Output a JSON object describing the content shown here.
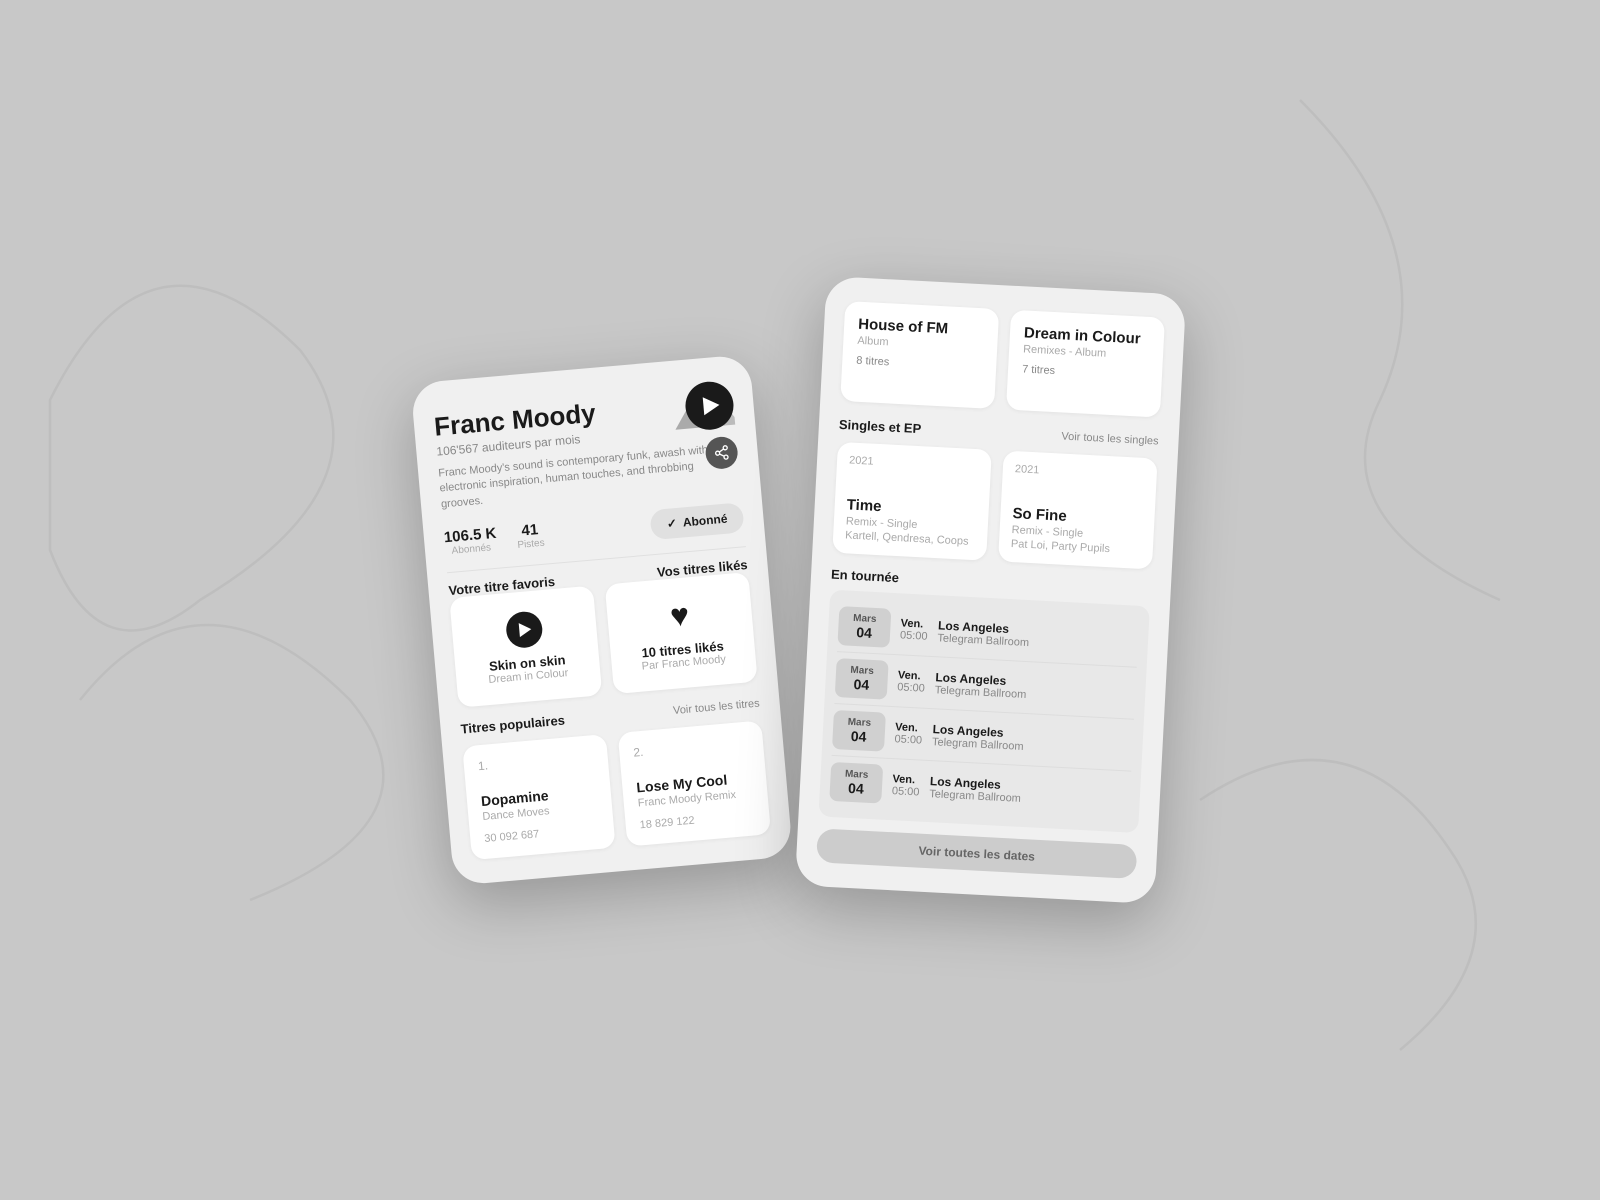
{
  "background": {
    "color": "#c8c8c8"
  },
  "leftPhone": {
    "artist": {
      "name": "Franc Moody",
      "listeners": "106'567 auditeurs par mois",
      "bio": "Franc Moody's sound is contemporary funk, awash with electronic inspiration, human touches, and throbbing grooves.",
      "stats": {
        "followers": "106.5 K",
        "followers_label": "Abonnés",
        "tracks": "41",
        "tracks_label": "Pistes"
      },
      "subscribe_label": "Abonné"
    },
    "favorite_section": {
      "title": "Votre titre favoris",
      "track_title": "Skin on skin",
      "track_album": "Dream in Colour"
    },
    "liked_section": {
      "title": "Vos titres likés",
      "count": "10 titres likés",
      "by": "Par Franc Moody"
    },
    "popular_section": {
      "title": "Titres populaires",
      "link": "Voir tous les titres",
      "tracks": [
        {
          "number": "1.",
          "title": "Dopamine",
          "album": "Dance Moves",
          "plays": "30 092 687"
        },
        {
          "number": "2.",
          "title": "Lose My Cool",
          "subtitle": "Franc Moody Remix",
          "plays": "18 829 122"
        }
      ]
    }
  },
  "rightPhone": {
    "albums_section": {
      "items": [
        {
          "title": "House of FM",
          "type": "Album",
          "tracks": "8 titres"
        },
        {
          "title": "Dream in Colour",
          "type": "Remixes - Album",
          "tracks": "7 titres"
        }
      ]
    },
    "singles_section": {
      "title": "Singles et EP",
      "link": "Voir tous les singles",
      "items": [
        {
          "year": "2021",
          "title": "Time",
          "type": "Remix - Single",
          "artists": "Kartell, Qendresa, Coops"
        },
        {
          "year": "2021",
          "title": "So Fine",
          "type": "Remix - Single",
          "artists": "Pat Loi, Party Pupils"
        }
      ]
    },
    "tour_section": {
      "title": "En tournée",
      "events": [
        {
          "month": "Mars",
          "day": "04",
          "day_name": "Ven.",
          "time": "05:00",
          "city": "Los Angeles",
          "venue": "Telegram Ballroom"
        },
        {
          "month": "Mars",
          "day": "04",
          "day_name": "Ven.",
          "time": "05:00",
          "city": "Los Angeles",
          "venue": "Telegram Ballroom"
        },
        {
          "month": "Mars",
          "day": "04",
          "day_name": "Ven.",
          "time": "05:00",
          "city": "Los Angeles",
          "venue": "Telegram Ballroom"
        },
        {
          "month": "Mars",
          "day": "04",
          "day_name": "Ven.",
          "time": "05:00",
          "city": "Los Angeles",
          "venue": "Telegram Ballroom"
        }
      ],
      "btn_label": "Voir toutes les dates"
    }
  }
}
